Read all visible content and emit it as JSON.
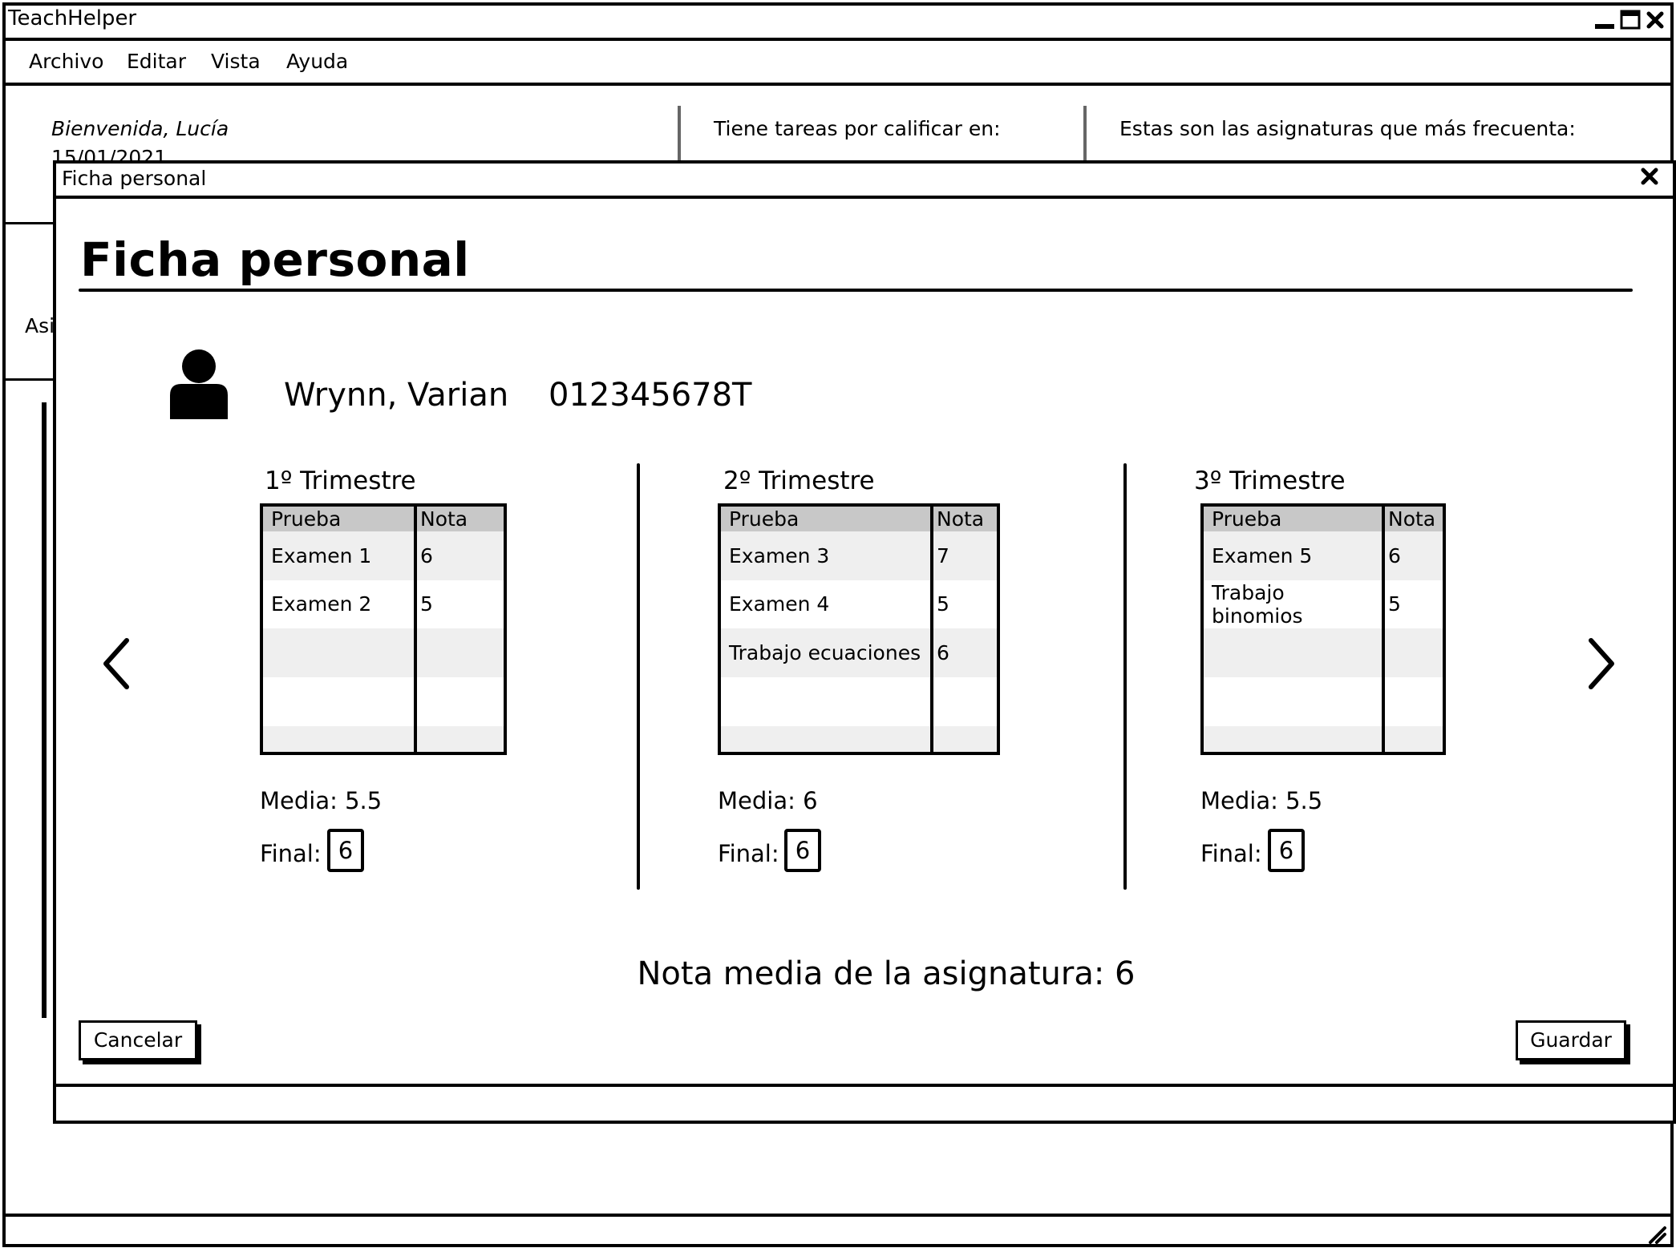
{
  "window": {
    "title": "TeachHelper"
  },
  "menu": {
    "items": [
      "Archivo",
      "Editar",
      "Vista",
      "Ayuda"
    ]
  },
  "background": {
    "welcome": "Bienvenida, Lucía",
    "date": "15/01/2021",
    "pending_tasks": "Tiene tareas por calificar en:",
    "frequent_subjects": "Estas son las asignaturas que más frecuenta:",
    "partial_label": "Asi"
  },
  "dialog": {
    "title": "Ficha personal",
    "heading": "Ficha personal",
    "student": {
      "name": "Wrynn, Varian",
      "id": "012345678T"
    },
    "column_headers": {
      "test": "Prueba",
      "grade": "Nota"
    },
    "labels": {
      "media": "Media:",
      "final": "Final:"
    },
    "trimesters": [
      {
        "title": "1º Trimestre",
        "rows": [
          [
            "Examen 1",
            "6"
          ],
          [
            "Examen 2",
            "5"
          ],
          [
            "",
            ""
          ],
          [
            "",
            ""
          ],
          [
            "",
            ""
          ]
        ],
        "media_value": "5.5",
        "final": "6"
      },
      {
        "title": "2º Trimestre",
        "rows": [
          [
            "Examen 3",
            "7"
          ],
          [
            "Examen 4",
            "5"
          ],
          [
            "Trabajo ecuaciones",
            "6"
          ],
          [
            "",
            ""
          ],
          [
            "",
            ""
          ]
        ],
        "media_value": "6",
        "final": "6"
      },
      {
        "title": "3º Trimestre",
        "rows": [
          [
            "Examen 5",
            "6"
          ],
          [
            "Trabajo binomios",
            "5"
          ],
          [
            "",
            ""
          ],
          [
            "",
            ""
          ],
          [
            "",
            ""
          ]
        ],
        "media_value": "5.5",
        "final": "6"
      }
    ],
    "overall_average": "Nota media de la asignatura: 6",
    "buttons": {
      "cancel": "Cancelar",
      "save": "Guardar"
    }
  }
}
